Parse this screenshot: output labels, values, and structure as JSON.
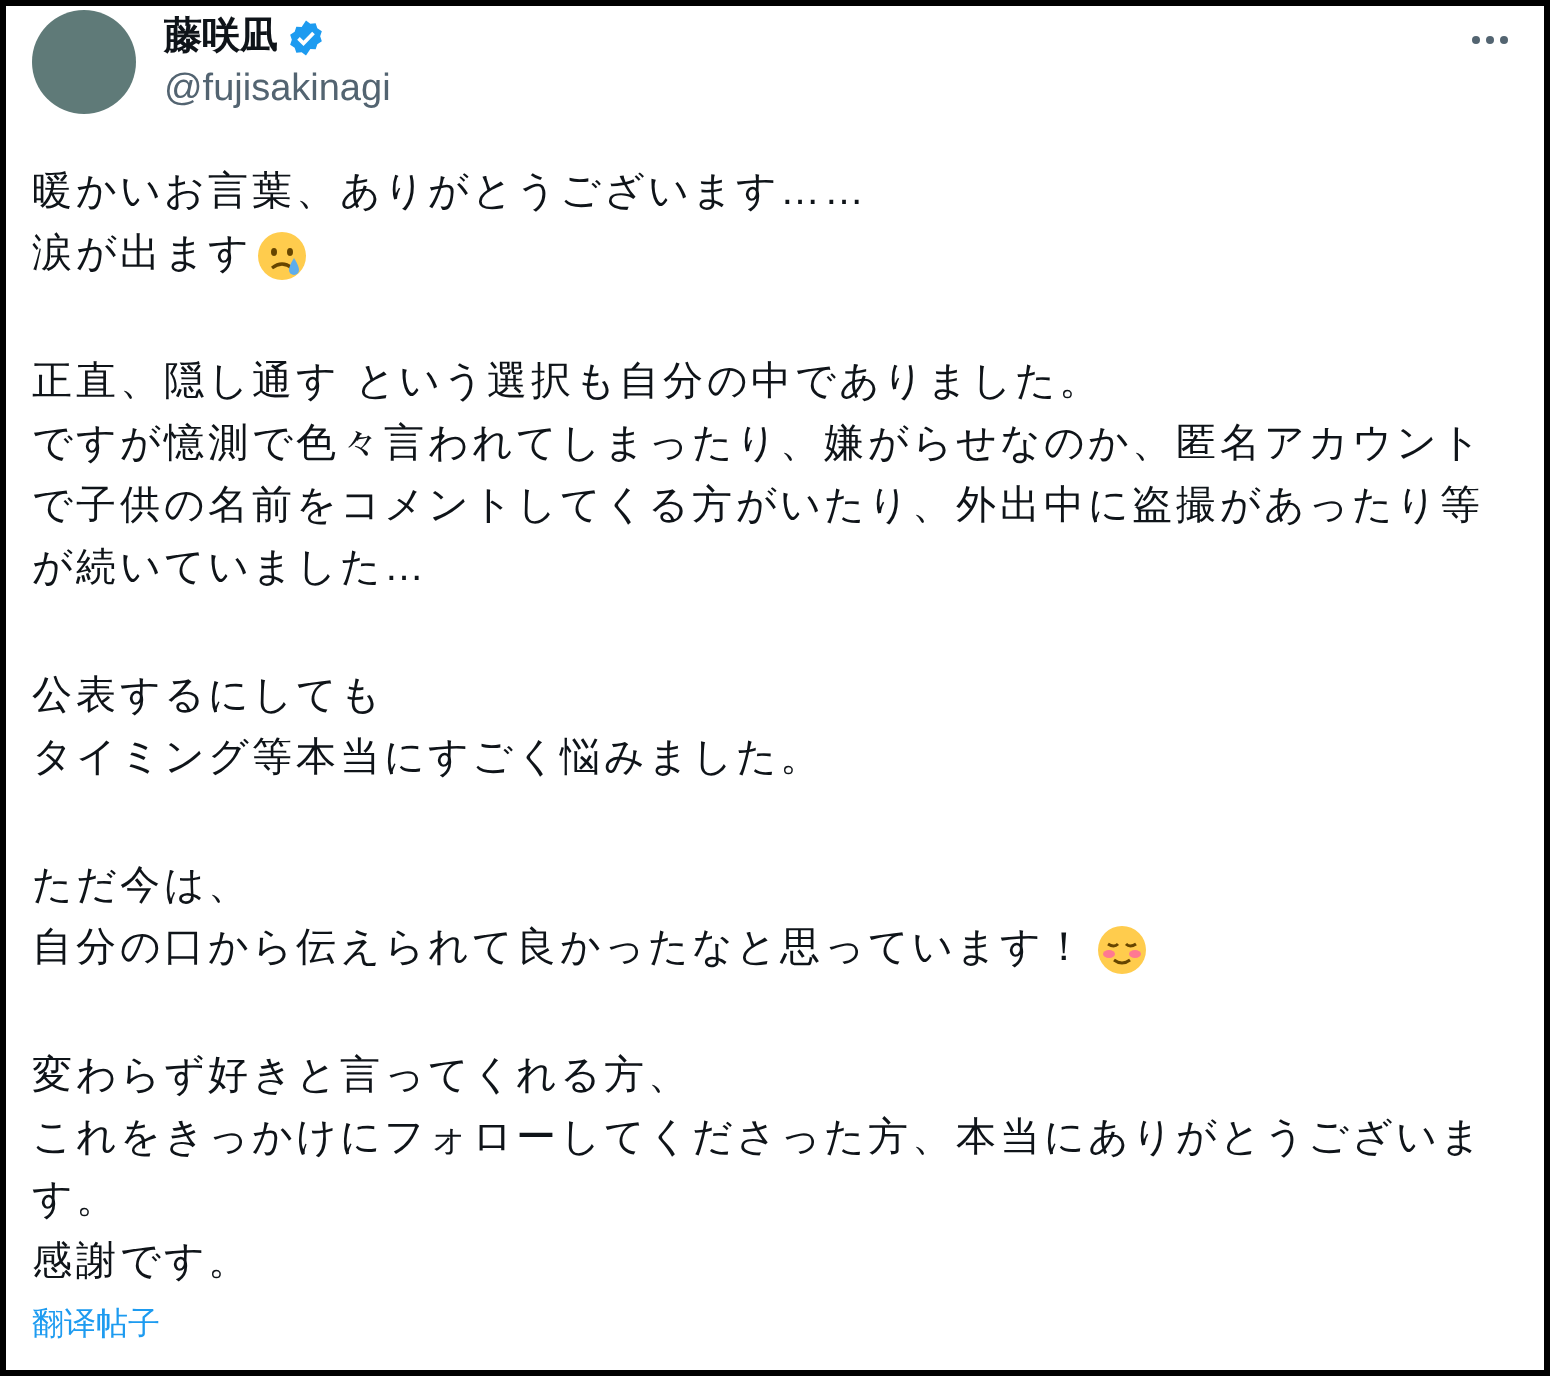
{
  "author": {
    "name": "藤咲凪",
    "verified": true,
    "handle": "@fujisakinagi"
  },
  "paragraphs": [
    {
      "lines": [
        {
          "text": "暖かいお言葉、ありがとうございます……"
        },
        {
          "text": "涙が出ます",
          "kind": "tear"
        }
      ]
    },
    {
      "lines": [
        {
          "text": "正直、隠し通す という選択も自分の中でありました。"
        },
        {
          "text": "ですが憶測で色々言われてしまったり、嫌がらせなのか、匿名アカウント"
        },
        {
          "text": "で子供の名前をコメントしてくる方がいたり、外出中に盗撮があったり等"
        },
        {
          "text": "が続いていました…"
        }
      ]
    },
    {
      "lines": [
        {
          "text": "公表するにしても"
        },
        {
          "text": "タイミング等本当にすごく悩みました。"
        }
      ]
    },
    {
      "lines": [
        {
          "text": "ただ今は、"
        },
        {
          "text": "自分の口から伝えられて良かったなと思っています！",
          "kind": "blush"
        }
      ]
    },
    {
      "lines": [
        {
          "text": "変わらず好きと言ってくれる方、"
        },
        {
          "text": "これをきっかけにフォローしてくださった方、本当にありがとうございま"
        },
        {
          "text": "す。"
        },
        {
          "text": "感謝です。"
        }
      ]
    }
  ],
  "translate_link": "翻译帖子"
}
